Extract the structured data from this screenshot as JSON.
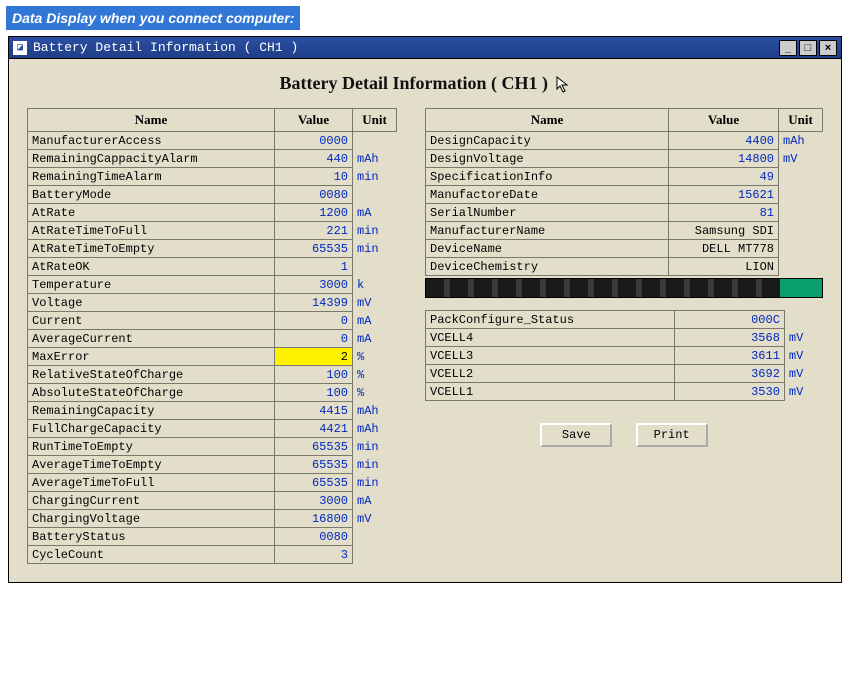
{
  "caption": "Data Display when you connect computer:",
  "window": {
    "title": "Battery Detail Information ( CH1 )"
  },
  "page_title": "Battery Detail Information ( CH1 )",
  "headers": {
    "name": "Name",
    "value": "Value",
    "unit": "Unit"
  },
  "left_rows": [
    {
      "name": "ManufacturerAccess",
      "value": "0000",
      "unit": ""
    },
    {
      "name": "RemainingCappacityAlarm",
      "value": "440",
      "unit": "mAh"
    },
    {
      "name": "RemainingTimeAlarm",
      "value": "10",
      "unit": "min"
    },
    {
      "name": "BatteryMode",
      "value": "0080",
      "unit": ""
    },
    {
      "name": "AtRate",
      "value": "1200",
      "unit": "mA"
    },
    {
      "name": "AtRateTimeToFull",
      "value": "221",
      "unit": "min"
    },
    {
      "name": "AtRateTimeToEmpty",
      "value": "65535",
      "unit": "min"
    },
    {
      "name": "AtRateOK",
      "value": "1",
      "unit": ""
    },
    {
      "name": "Temperature",
      "value": "3000",
      "unit": "k"
    },
    {
      "name": "Voltage",
      "value": "14399",
      "unit": "mV"
    },
    {
      "name": "Current",
      "value": "0",
      "unit": "mA"
    },
    {
      "name": "AverageCurrent",
      "value": "0",
      "unit": "mA"
    },
    {
      "name": "MaxError",
      "value": "2",
      "unit": "%",
      "highlight": true
    },
    {
      "name": "RelativeStateOfCharge",
      "value": "100",
      "unit": "%"
    },
    {
      "name": "AbsoluteStateOfCharge",
      "value": "100",
      "unit": "%"
    },
    {
      "name": "RemainingCapacity",
      "value": "4415",
      "unit": "mAh"
    },
    {
      "name": "FullChargeCapacity",
      "value": "4421",
      "unit": "mAh"
    },
    {
      "name": "RunTimeToEmpty",
      "value": "65535",
      "unit": "min"
    },
    {
      "name": "AverageTimeToEmpty",
      "value": "65535",
      "unit": "min"
    },
    {
      "name": "AverageTimeToFull",
      "value": "65535",
      "unit": "min"
    },
    {
      "name": "ChargingCurrent",
      "value": "3000",
      "unit": "mA"
    },
    {
      "name": "ChargingVoltage",
      "value": "16800",
      "unit": "mV"
    },
    {
      "name": "BatteryStatus",
      "value": "0080",
      "unit": ""
    },
    {
      "name": "CycleCount",
      "value": "3",
      "unit": ""
    }
  ],
  "right_rows_top": [
    {
      "name": "DesignCapacity",
      "value": "4400",
      "unit": "mAh"
    },
    {
      "name": "DesignVoltage",
      "value": "14800",
      "unit": "mV"
    },
    {
      "name": "SpecificationInfo",
      "value": "49",
      "unit": ""
    },
    {
      "name": "ManufactoreDate",
      "value": "15621",
      "unit": ""
    },
    {
      "name": "SerialNumber",
      "value": "81",
      "unit": ""
    },
    {
      "name": "ManufacturerName",
      "value": "Samsung SDI",
      "unit": "",
      "text": true
    },
    {
      "name": "DeviceName",
      "value": "DELL MT778",
      "unit": "",
      "text": true
    },
    {
      "name": "DeviceChemistry",
      "value": "LION",
      "unit": "",
      "text": true
    }
  ],
  "right_rows_bottom": [
    {
      "name": "PackConfigure_Status",
      "value": "000C",
      "unit": ""
    },
    {
      "name": "VCELL4",
      "value": "3568",
      "unit": "mV"
    },
    {
      "name": "VCELL3",
      "value": "3611",
      "unit": "mV"
    },
    {
      "name": "VCELL2",
      "value": "3692",
      "unit": "mV"
    },
    {
      "name": "VCELL1",
      "value": "3530",
      "unit": "mV"
    }
  ],
  "buttons": {
    "save": "Save",
    "print": "Print"
  }
}
